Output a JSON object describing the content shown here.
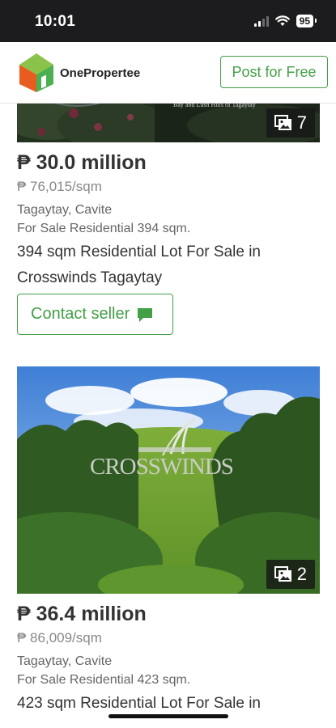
{
  "status": {
    "time": "10:01",
    "battery": "95"
  },
  "header": {
    "brand": "OnePropertee",
    "post_button": "Post for Free"
  },
  "listings": [
    {
      "photo_caption": "Bay and Lush Hills of Tagaytay",
      "photo_count": "7",
      "price": "₱ 30.0 million",
      "per_sqm": "₱ 76,015/sqm",
      "location": "Tagaytay, Cavite",
      "type": "For Sale Residential 394 sqm.",
      "title": "394 sqm Residential Lot For Sale in Crosswinds Tagaytay",
      "contact_label": "Contact seller"
    },
    {
      "photo_sign": "CROSSWINDS",
      "photo_count": "2",
      "price": "₱ 36.4 million",
      "per_sqm": "₱ 86,009/sqm",
      "location": "Tagaytay, Cavite",
      "type": "For Sale Residential 423 sqm.",
      "title": "423 sqm Residential Lot For Sale in"
    }
  ],
  "colors": {
    "accent": "#43a047",
    "status_bar": "#1c1c1e"
  }
}
